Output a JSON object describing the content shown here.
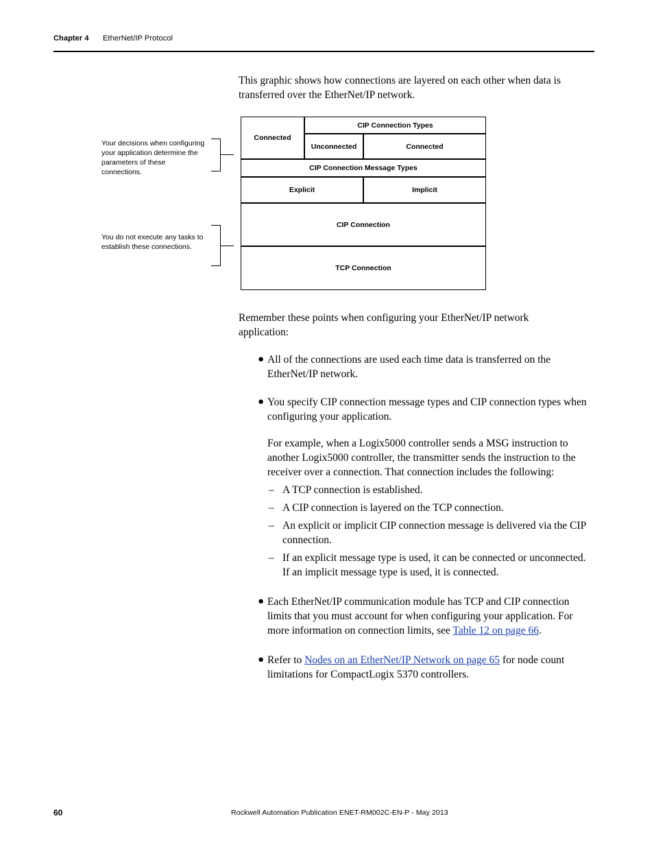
{
  "header": {
    "chapter": "Chapter 4",
    "title": "EtherNet/IP Protocol"
  },
  "intro": {
    "paragraph": "This graphic shows how connections are layered on each other when data is transferred over the EtherNet/IP network."
  },
  "diagram": {
    "cip_connection_types_header": "CIP Connection Types",
    "connected_left": "Connected",
    "unconnected": "Unconnected",
    "connected_right": "Connected",
    "cip_connection_message_types_header": "CIP Connection Message Types",
    "explicit": "Explicit",
    "implicit": "Implicit",
    "cip_connection": "CIP Connection",
    "tcp_connection": "TCP Connection",
    "callout_top": "Your decisions when configuring your application determine the parameters of these connections.",
    "callout_bottom": "You do not execute any tasks to establish these connections."
  },
  "body": {
    "remember_intro": "Remember these points when configuring your EtherNet/IP network application:",
    "bullets": [
      {
        "text": "All of the connections are used each time data is transferred on the EtherNet/IP network."
      },
      {
        "text": "You specify CIP connection message types and CIP connection types when configuring your application.",
        "sub_paragraph": "For example, when a Logix5000 controller sends a MSG instruction to another Logix5000 controller, the transmitter sends the instruction to the receiver over a connection. That connection includes the following:",
        "dashes": [
          "A TCP connection is established.",
          "A CIP connection is layered on the TCP connection.",
          "An explicit or implicit CIP connection message is delivered via the CIP connection.",
          "If an explicit message type is used, it can be connected or unconnected. If an implicit message type is used, it is connected."
        ]
      },
      {
        "text_before": "Each EtherNet/IP communication module has TCP and CIP connection limits that you must account for when configuring your application. For more information on connection limits, see ",
        "link": "Table 12 on page 66",
        "text_after": "."
      },
      {
        "text_before": "Refer to ",
        "link": "Nodes on an EtherNet/IP Network on page 65",
        "text_after": " for node count limitations for CompactLogix 5370 controllers."
      }
    ]
  },
  "footer": {
    "page_number": "60",
    "publication": "Rockwell Automation Publication ENET-RM002C-EN-P - May 2013"
  },
  "bullet_glyph": "●",
  "dash_glyph": "–"
}
